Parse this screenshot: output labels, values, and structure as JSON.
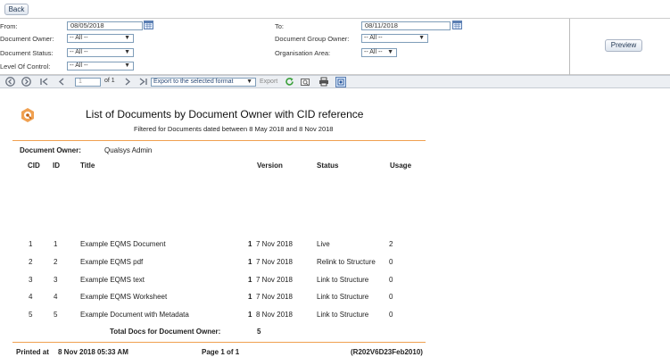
{
  "back_label": "Back",
  "filters": {
    "from_label": "From:",
    "from_value": "08/05/2018",
    "to_label": "To:",
    "to_value": "08/11/2018",
    "document_owner_label": "Document Owner:",
    "document_owner_value": "-- All --",
    "document_group_owner_label": "Document Group Owner:",
    "document_group_owner_value": "-- All --",
    "document_status_label": "Document Status:",
    "document_status_value": "-- All --",
    "organisation_area_label": "Organisation Area:",
    "organisation_area_value": "-- All --",
    "level_of_control_label": "Level Of Control:",
    "level_of_control_value": "-- All --",
    "preview_label": "Preview"
  },
  "toolbar": {
    "page_value": "1",
    "page_of": "of 1",
    "format_select": "Export to the selected format",
    "export_label": "Export"
  },
  "report": {
    "title": "List of Documents by Document Owner with CID reference",
    "subtitle": "Filtered for Documents dated between 8 May 2018 and 8 Nov 2018",
    "owner_label": "Document Owner:",
    "owner_value": "Qualsys Admin",
    "columns": [
      "CID",
      "ID",
      "Title",
      "Version",
      "Status",
      "Usage"
    ],
    "rows": [
      {
        "cid": "1",
        "id": "1",
        "title": "Example EQMS Document",
        "version": "1",
        "date": "7 Nov 2018",
        "status": "Live",
        "usage": "2"
      },
      {
        "cid": "2",
        "id": "2",
        "title": "Example EQMS pdf",
        "version": "1",
        "date": "7 Nov 2018",
        "status": "Relink to Structure",
        "usage": "0"
      },
      {
        "cid": "3",
        "id": "3",
        "title": "Example EQMS text",
        "version": "1",
        "date": "7 Nov 2018",
        "status": "Link to Structure",
        "usage": "0"
      },
      {
        "cid": "4",
        "id": "4",
        "title": "Example EQMS Worksheet",
        "version": "1",
        "date": "7 Nov 2018",
        "status": "Link to Structure",
        "usage": "0"
      },
      {
        "cid": "5",
        "id": "5",
        "title": "Example Document with Metadata",
        "version": "1",
        "date": "8 Nov 2018",
        "status": "Link to Structure",
        "usage": "0"
      }
    ],
    "total_label": "Total Docs for Document Owner:",
    "total_value": "5",
    "printed_label": "Printed at",
    "printed_value": "8 Nov 2018 05:33 AM",
    "page_label": "Page 1 of 1",
    "report_code": "(R202V6D23Feb2010)"
  },
  "colors": {
    "accent": "#f0a050",
    "logo": "#f0a050"
  }
}
